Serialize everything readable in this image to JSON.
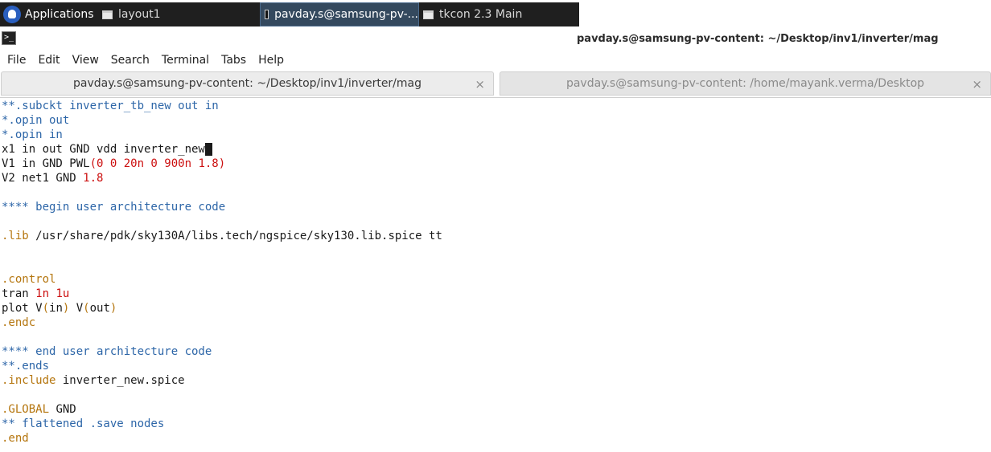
{
  "taskbar": {
    "applications_label": "Applications",
    "windows": [
      {
        "label": "layout1",
        "icon": "window-icon"
      },
      {
        "label": "pavday.s@samsung-pv-...",
        "icon": "terminal-icon",
        "active": true
      },
      {
        "label": "tkcon 2.3 Main",
        "icon": "window-icon"
      }
    ]
  },
  "window": {
    "title": "pavday.s@samsung-pv-content: ~/Desktop/inv1/inverter/mag"
  },
  "menu": [
    "File",
    "Edit",
    "View",
    "Search",
    "Terminal",
    "Tabs",
    "Help"
  ],
  "tabs": [
    {
      "label": "pavday.s@samsung-pv-content: ~/Desktop/inv1/inverter/mag",
      "active": true
    },
    {
      "label": "pavday.s@samsung-pv-content: /home/mayank.verma/Desktop",
      "active": false
    }
  ],
  "tab_close_glyph": "×",
  "terminal": {
    "l1": "**.subckt inverter_tb_new out in",
    "l2": "*.opin out",
    "l3": "*.opin in",
    "l4": "x1 in out GND vdd inverter_new",
    "l5a": "V1 in GND PWL",
    "l5b": "(0 0 20n 0 900n 1.8)",
    "l6a": "V2 net1 GND ",
    "l6b": "1.8",
    "l8": "**** begin user architecture code",
    "l10a": ".lib",
    "l10b": " /usr/share/pdk/sky130A/libs.tech/ngspice/sky130.lib.spice tt",
    "l13": ".control",
    "l14a": "tran ",
    "l14b": "1n 1u",
    "l15a": "plot V",
    "l15b": "(",
    "l15c": "in",
    "l15d": ")",
    "l15e": " V",
    "l15f": "(",
    "l15g": "out",
    "l15h": ")",
    "l16": ".endc",
    "l18": "**** end user architecture code",
    "l19": "**.ends",
    "l20a": ".include",
    "l20b": " inverter_new.spice",
    "l22a": ".GLOBAL",
    "l22b": " GND",
    "l23": "** flattened .save nodes",
    "l24": ".end"
  },
  "colors": {
    "comment": "#2d66a8",
    "keyword": "#b5760f",
    "number": "#cc1010"
  }
}
